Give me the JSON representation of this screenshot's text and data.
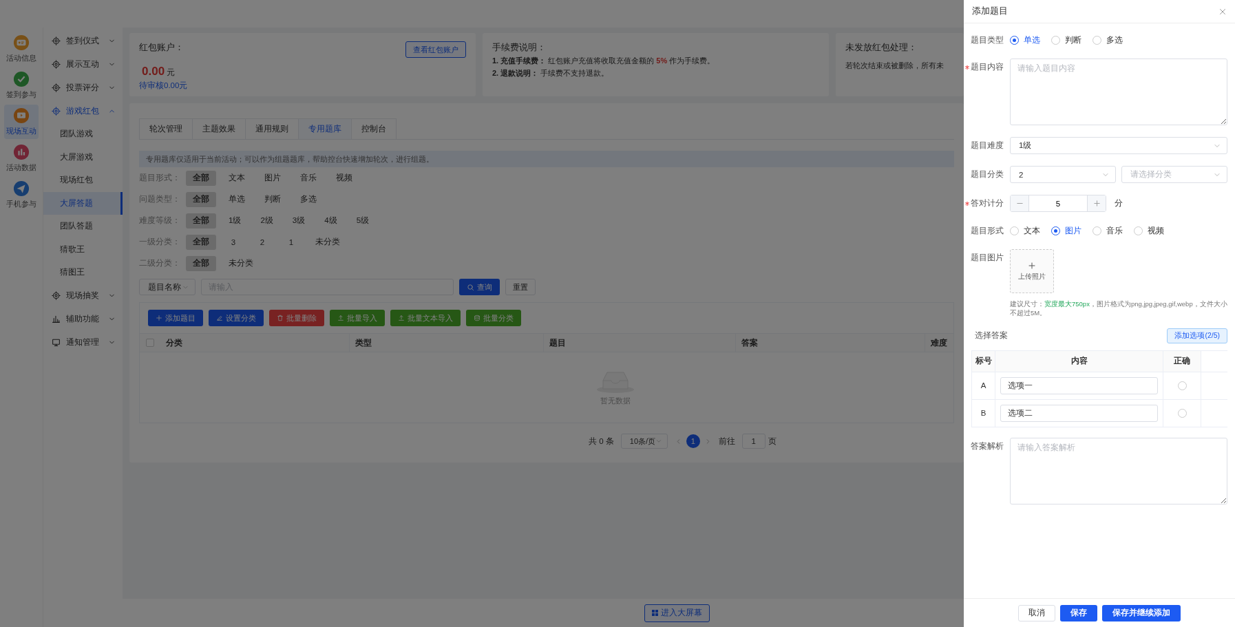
{
  "rail": [
    {
      "label": "活动信息",
      "selected": false
    },
    {
      "label": "签到参与",
      "selected": false
    },
    {
      "label": "现场互动",
      "selected": true
    },
    {
      "label": "活动数据",
      "selected": false
    },
    {
      "label": "手机参与",
      "selected": false
    }
  ],
  "menu": [
    {
      "label": "签到仪式",
      "expanded": false
    },
    {
      "label": "展示互动",
      "expanded": false
    },
    {
      "label": "投票评分",
      "expanded": false
    },
    {
      "label": "游戏红包",
      "expanded": true,
      "children": [
        {
          "label": "团队游戏",
          "selected": false
        },
        {
          "label": "大屏游戏",
          "selected": false
        },
        {
          "label": "现场红包",
          "selected": false
        },
        {
          "label": "大屏答题",
          "selected": true
        },
        {
          "label": "团队答题",
          "selected": false
        },
        {
          "label": "猜歌王",
          "selected": false
        },
        {
          "label": "猜图王",
          "selected": false
        }
      ]
    },
    {
      "label": "现场抽奖",
      "expanded": false
    },
    {
      "label": "辅助功能",
      "expanded": false
    },
    {
      "label": "通知管理",
      "expanded": false
    }
  ],
  "account_card": {
    "title": "红包账户：",
    "amount": "0.00",
    "unit": "元",
    "pending": "待审核0.00元",
    "button": "查看红包账户"
  },
  "fee_card": {
    "title": "手续费说明：",
    "lines": [
      "**1. 充值手续费：** 红包账户充值将收取充值金额的 **5%** 作为手续费。",
      "**2. 退款说明：** 手续费不支持退款。"
    ]
  },
  "unreleased_card": {
    "title": "未发放红包处理：",
    "text": "若轮次结束或被删除，所有未"
  },
  "tabs": [
    {
      "label": "轮次管理",
      "selected": false
    },
    {
      "label": "主题效果",
      "selected": false
    },
    {
      "label": "通用规则",
      "selected": false
    },
    {
      "label": "专用题库",
      "selected": true
    },
    {
      "label": "控制台",
      "selected": false
    }
  ],
  "notice": "专用题库仅适用于当前活动；可以作为组题题库，帮助控台快速增加轮次，进行组题。",
  "filters": [
    {
      "label": "题目形式：",
      "options": [
        {
          "label": "全部",
          "selected": true
        },
        {
          "label": "文本",
          "selected": false
        },
        {
          "label": "图片",
          "selected": false
        },
        {
          "label": "音乐",
          "selected": false
        },
        {
          "label": "视频",
          "selected": false
        }
      ]
    },
    {
      "label": "问题类型：",
      "options": [
        {
          "label": "全部",
          "selected": true
        },
        {
          "label": "单选",
          "selected": false
        },
        {
          "label": "判断",
          "selected": false
        },
        {
          "label": "多选",
          "selected": false
        }
      ]
    },
    {
      "label": "难度等级：",
      "options": [
        {
          "label": "全部",
          "selected": true
        },
        {
          "label": "1级",
          "selected": false
        },
        {
          "label": "2级",
          "selected": false
        },
        {
          "label": "3级",
          "selected": false
        },
        {
          "label": "4级",
          "selected": false
        },
        {
          "label": "5级",
          "selected": false
        }
      ]
    },
    {
      "label": "一级分类：",
      "options": [
        {
          "label": "全部",
          "selected": true
        },
        {
          "label": "3",
          "selected": false
        },
        {
          "label": "2",
          "selected": false
        },
        {
          "label": "1",
          "selected": false
        },
        {
          "label": "未分类",
          "selected": false
        }
      ]
    },
    {
      "label": "二级分类：",
      "options": [
        {
          "label": "全部",
          "selected": true
        },
        {
          "label": "未分类",
          "selected": false
        }
      ]
    }
  ],
  "search": {
    "field": "题目名称",
    "placeholder": "请输入",
    "search_button": "查询",
    "reset_button": "重置"
  },
  "toolbar": [
    {
      "label": "添加题目",
      "kind": "primary"
    },
    {
      "label": "设置分类",
      "kind": "primary"
    },
    {
      "label": "批量删除",
      "kind": "danger"
    },
    {
      "label": "批量导入",
      "kind": "success"
    },
    {
      "label": "批量文本导入",
      "kind": "success"
    },
    {
      "label": "批量分类",
      "kind": "success"
    }
  ],
  "table": {
    "all_checked": false,
    "columns": [
      "分类",
      "类型",
      "题目",
      "答案",
      "难度"
    ],
    "empty_text": "暂无数据"
  },
  "pagination": {
    "total": "共 0 条",
    "page_size": "10条/页",
    "pages": [
      {
        "label": "1",
        "selected": true
      }
    ],
    "goto_label": "前往",
    "goto_value": "1",
    "goto_suffix": "页"
  },
  "enter_button": "进入大屏幕",
  "drawer": {
    "title": "添加题目",
    "fields": [
      {
        "kind": "radio",
        "label": "题目类型",
        "required": false,
        "options": [
          {
            "label": "单选",
            "selected": true
          },
          {
            "label": "判断",
            "selected": false
          },
          {
            "label": "多选",
            "selected": false
          }
        ]
      },
      {
        "kind": "textarea",
        "label": "题目内容",
        "required": true,
        "placeholder": "请输入题目内容"
      },
      {
        "kind": "select",
        "label": "题目难度",
        "required": false,
        "selects": [
          {
            "value": "1级"
          }
        ]
      },
      {
        "kind": "select",
        "label": "题目分类",
        "required": false,
        "selects": [
          {
            "value": "2"
          },
          {
            "placeholder": "请选择分类"
          }
        ]
      },
      {
        "kind": "stepper",
        "label": "答对计分",
        "required": true,
        "value": "5",
        "unit": "分"
      },
      {
        "kind": "radio",
        "label": "题目形式",
        "required": false,
        "options": [
          {
            "label": "文本",
            "selected": false
          },
          {
            "label": "图片",
            "selected": true
          },
          {
            "label": "音乐",
            "selected": false
          },
          {
            "label": "视频",
            "selected": false
          }
        ]
      },
      {
        "kind": "upload",
        "label": "题目图片",
        "required": false,
        "caption": "上传照片",
        "hint": "建议尺寸：**宽度最大750px**，图片格式为png,jpg,jpeg,gif,webp，文件大小不超过5M。"
      },
      {
        "kind": "answers",
        "label": "选择答案",
        "required": false,
        "add_button": "添加选项(2/5)",
        "columns": [
          "标号",
          "内容",
          "正确"
        ],
        "rows": [
          {
            "key": "A",
            "value": "选项一",
            "correct": false
          },
          {
            "key": "B",
            "value": "选项二",
            "correct": false
          }
        ]
      },
      {
        "kind": "textarea",
        "label": "答案解析",
        "required": false,
        "placeholder": "请输入答案解析"
      }
    ],
    "buttons": [
      {
        "label": "取消",
        "kind": "default"
      },
      {
        "label": "保存",
        "kind": "primary"
      },
      {
        "label": "保存并继续添加",
        "kind": "primary"
      }
    ]
  }
}
